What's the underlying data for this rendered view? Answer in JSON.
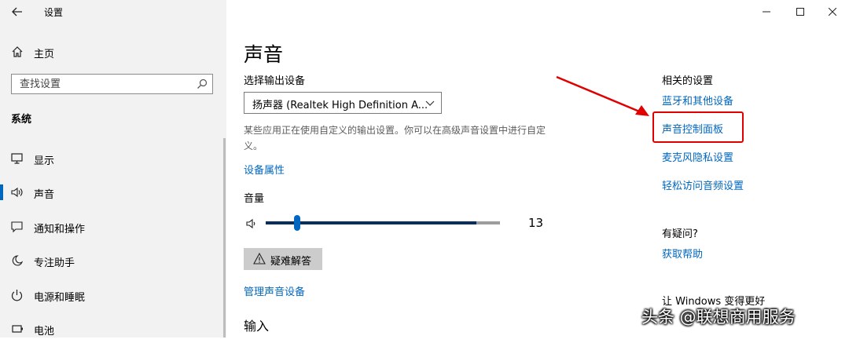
{
  "window": {
    "title": "设置",
    "controls": [
      "minimize-icon",
      "maximize-icon",
      "close-icon"
    ]
  },
  "sidebar": {
    "home_label": "主页",
    "search_placeholder": "查找设置",
    "section_label": "系统",
    "items": [
      {
        "label": "显示",
        "icon": "monitor-icon"
      },
      {
        "label": "声音",
        "icon": "speaker-icon",
        "active": true
      },
      {
        "label": "通知和操作",
        "icon": "notification-icon"
      },
      {
        "label": "专注助手",
        "icon": "moon-icon"
      },
      {
        "label": "电源和睡眠",
        "icon": "power-icon"
      },
      {
        "label": "电池",
        "icon": "battery-icon"
      }
    ]
  },
  "main": {
    "title": "声音",
    "output_label": "选择输出设备",
    "output_device": "扬声器 (Realtek High Definition A...",
    "description": "某些应用正在使用自定义的输出设置。你可以在高级声音设置中进行自定义。",
    "device_properties_link": "设备属性",
    "volume_label": "音量",
    "volume_value": "13",
    "volume_level": 13,
    "troubleshoot_label": "疑难解答",
    "manage_devices_link": "管理声音设备",
    "input_heading": "输入"
  },
  "related": {
    "title": "相关的设置",
    "links": [
      "蓝牙和其他设备",
      "声音控制面板",
      "麦克风隐私设置",
      "轻松访问音频设置"
    ],
    "question_title": "有疑问?",
    "help_link": "获取帮助",
    "better_title": "让 Windows 变得更好"
  },
  "annotation": {
    "highlight_color": "#e00000",
    "watermark": "头条 @联想商用服务"
  },
  "colors": {
    "accent": "#0067c0",
    "sidebar_bg": "#f2f2f2",
    "slider_fill": "#0b2d57"
  }
}
